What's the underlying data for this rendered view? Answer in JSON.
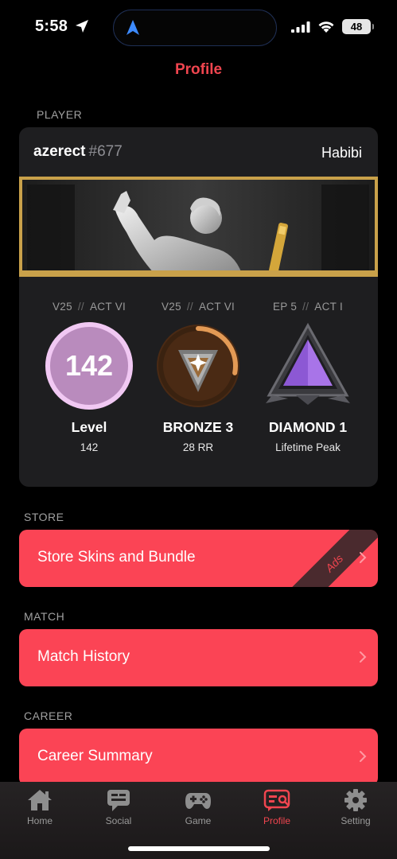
{
  "status_bar": {
    "time": "5:58",
    "battery": "48"
  },
  "header": {
    "title": "Profile"
  },
  "sections": {
    "player": "PLAYER",
    "store": "STORE",
    "match": "MATCH",
    "career": "CAREER"
  },
  "player": {
    "name": "azerect",
    "tag": "#677",
    "title": "Habibi",
    "stats": [
      {
        "season_v": "V25",
        "season_act": "ACT VI",
        "icon": "level-badge",
        "value": "142",
        "title": "Level",
        "sub": "142"
      },
      {
        "season_v": "V25",
        "season_act": "ACT VI",
        "icon": "bronze-rank-icon",
        "title": "BRONZE 3",
        "sub": "28 RR",
        "rr_progress": 0.28
      },
      {
        "season_v": "EP 5",
        "season_act": "ACT I",
        "icon": "diamond-rank-icon",
        "title": "DIAMOND 1",
        "sub": "Lifetime Peak"
      }
    ],
    "separator": "//"
  },
  "buttons": {
    "store": "Store Skins and Bundle",
    "store_badge": "Ads",
    "match": "Match History",
    "career": "Career Summary"
  },
  "tabs": [
    {
      "label": "Home",
      "icon": "home-icon"
    },
    {
      "label": "Social",
      "icon": "chat-icon"
    },
    {
      "label": "Game",
      "icon": "gamepad-icon"
    },
    {
      "label": "Profile",
      "icon": "profile-card-icon",
      "active": true
    },
    {
      "label": "Setting",
      "icon": "gear-icon"
    }
  ],
  "colors": {
    "accent": "#fb4455",
    "level_ring": "#f1c8f3",
    "level_fill": "#b98bbd",
    "diamond": "#a874e8"
  }
}
